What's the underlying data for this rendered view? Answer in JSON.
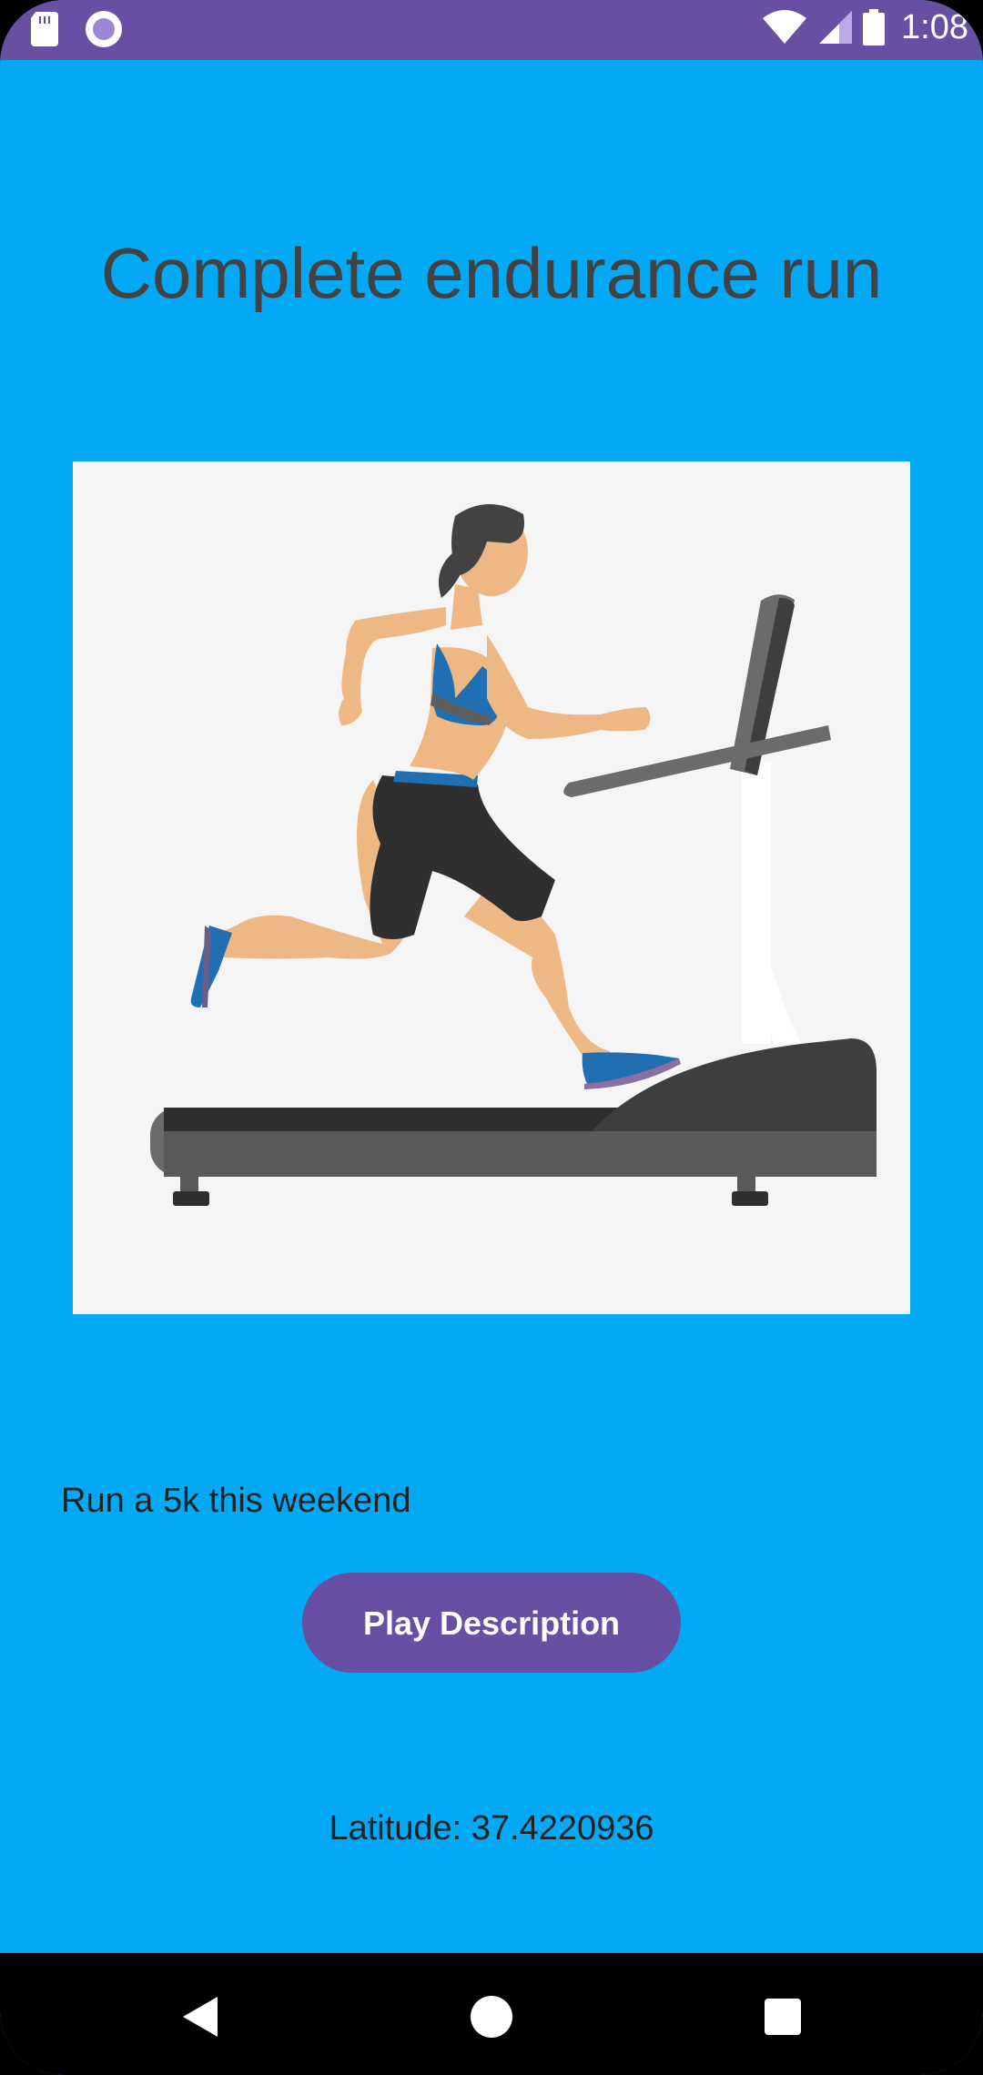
{
  "status_bar": {
    "time": "1:08",
    "icons": [
      "sd-card-icon",
      "record-icon",
      "wifi-icon",
      "signal-icon",
      "battery-icon"
    ]
  },
  "title": "Complete endurance run",
  "image": {
    "subject": "woman-running-on-treadmill-illustration"
  },
  "description": "Run a 5k this weekend",
  "play_button_label": "Play Description",
  "latitude_text": "Latitude: 37.4220936",
  "nav_bar": {
    "icons": [
      "back-icon",
      "home-icon",
      "recents-icon"
    ]
  },
  "colors": {
    "background": "#03A9F4",
    "status_bar": "#6750A4",
    "button": "#6750A4",
    "title_text": "#424242",
    "body_text": "#212121",
    "image_background": "#F5F5F5"
  }
}
